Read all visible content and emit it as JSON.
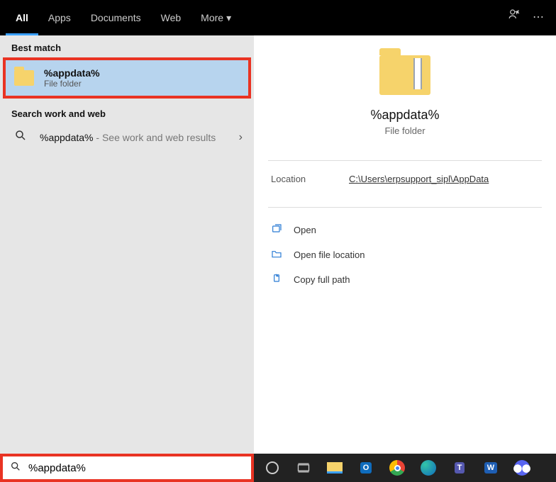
{
  "tabs": {
    "all": "All",
    "apps": "Apps",
    "documents": "Documents",
    "web": "Web",
    "more": "More"
  },
  "sections": {
    "best_match": "Best match",
    "search_work_web": "Search work and web"
  },
  "best": {
    "title": "%appdata%",
    "sub": "File folder"
  },
  "web_result": {
    "query": "%appdata%",
    "suffix": " - See work and web results"
  },
  "detail": {
    "title": "%appdata%",
    "sub": "File folder",
    "location_label": "Location",
    "location_value": "C:\\Users\\erpsupport_sipl\\AppData"
  },
  "actions": {
    "open": "Open",
    "open_loc": "Open file location",
    "copy_path": "Copy full path"
  },
  "search": {
    "value": "%appdata%"
  }
}
